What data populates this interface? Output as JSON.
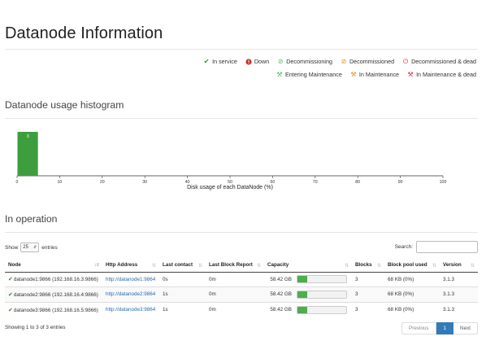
{
  "page": {
    "title": "Datanode Information"
  },
  "legend": {
    "row1": [
      {
        "icon": "check-icon",
        "label": "In service",
        "color": "#2e8b2e"
      },
      {
        "icon": "error-circle-icon",
        "label": "Down",
        "color": "#c9302c"
      },
      {
        "icon": "decommissioning-icon",
        "label": "Decommissioning",
        "color": "#5cb85c"
      },
      {
        "icon": "decommissioned-icon",
        "label": "Decommissioned",
        "color": "#e38d13"
      },
      {
        "icon": "power-icon",
        "label": "Decommissioned & dead",
        "color": "#c9302c"
      }
    ],
    "row2": [
      {
        "icon": "wrench-icon",
        "label": "Entering Maintenance",
        "color": "#5cb85c"
      },
      {
        "icon": "wrench-icon",
        "label": "In Maintenance",
        "color": "#e38d13"
      },
      {
        "icon": "wrench-icon",
        "label": "In Maintenance & dead",
        "color": "#c9302c"
      }
    ]
  },
  "histogram_section": {
    "title": "Datanode usage histogram"
  },
  "chart_data": {
    "type": "bar",
    "xlabel": "Disk usage of each DataNode (%)",
    "ylabel": "",
    "xlim": [
      0,
      100
    ],
    "xticks": [
      0,
      10,
      20,
      30,
      40,
      50,
      60,
      70,
      80,
      90,
      100
    ],
    "bins": [
      {
        "x0": 0,
        "x1": 5,
        "count": 3
      }
    ],
    "bar_color": "#3e9e3e"
  },
  "operation_section": {
    "title": "In operation"
  },
  "table_controls": {
    "show_label": "Show",
    "page_size": "25",
    "entries_label": "entries",
    "search_label": "Search:",
    "search_value": ""
  },
  "table": {
    "columns": [
      "Node",
      "Http Address",
      "Last contact",
      "Last Block Report",
      "Capacity",
      "Blocks",
      "Block pool used",
      "Version"
    ],
    "rows": [
      {
        "node": "datanode1:9866 (192.168.16.3:9866)",
        "http": "http://datanode1:9864",
        "last_contact": "0s",
        "last_block_report": "0m",
        "capacity": "58.42 GB",
        "capacity_used_fraction": 0.2,
        "blocks": "3",
        "pool_used": "68 KB (0%)",
        "version": "3.1.3"
      },
      {
        "node": "datanode2:9866 (192.168.16.4:9866)",
        "http": "http://datanode2:9864",
        "last_contact": "1s",
        "last_block_report": "0m",
        "capacity": "58.42 GB",
        "capacity_used_fraction": 0.2,
        "blocks": "3",
        "pool_used": "68 KB (0%)",
        "version": "3.1.3"
      },
      {
        "node": "datanode3:9866 (192.168.16.5:9866)",
        "http": "http://datanode3:9864",
        "last_contact": "1s",
        "last_block_report": "0m",
        "capacity": "58.42 GB",
        "capacity_used_fraction": 0.2,
        "blocks": "3",
        "pool_used": "68 KB (0%)",
        "version": "3.1.3"
      }
    ]
  },
  "footer": {
    "info": "Showing 1 to 3 of 3 entries",
    "previous": "Previous",
    "current_page": "1",
    "next": "Next"
  }
}
